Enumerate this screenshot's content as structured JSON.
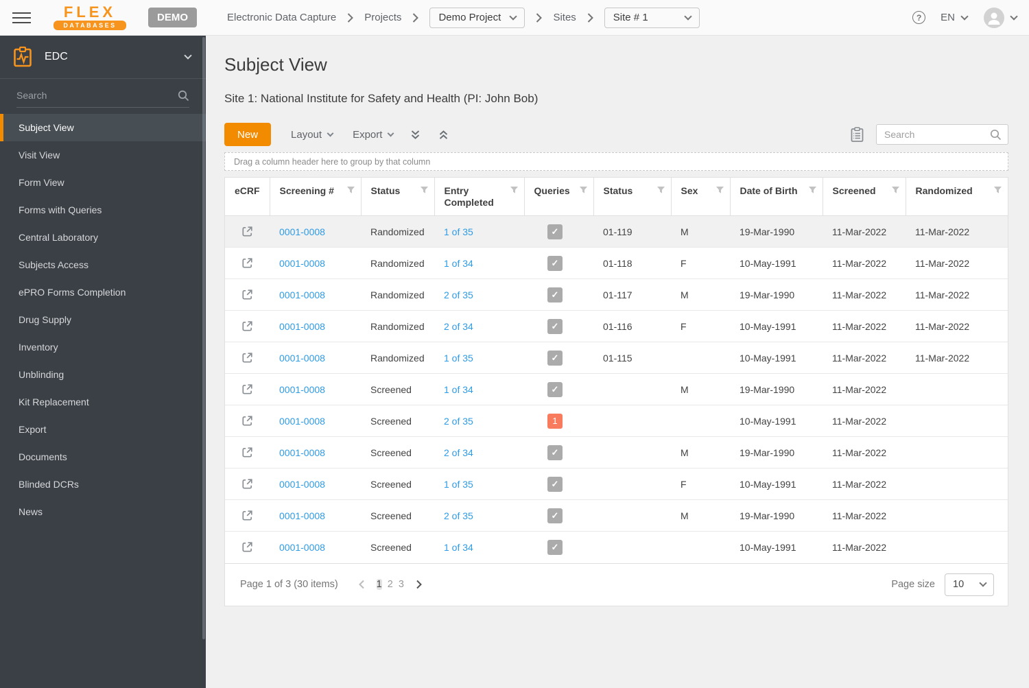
{
  "header": {
    "logo_line1": "FLEX",
    "logo_line2": "DATABASES",
    "demo_badge": "DEMO",
    "breadcrumb1": "Electronic Data Capture",
    "breadcrumb2": "Projects",
    "project_selected": "Demo Project",
    "breadcrumb3": "Sites",
    "site_selected": "Site # 1",
    "language": "EN"
  },
  "sidebar": {
    "module_label": "EDC",
    "search_placeholder": "Search",
    "items": [
      {
        "label": "Subject View",
        "active": true
      },
      {
        "label": "Visit View",
        "active": false
      },
      {
        "label": "Form View",
        "active": false
      },
      {
        "label": "Forms with Queries",
        "active": false
      },
      {
        "label": "Central Laboratory",
        "active": false
      },
      {
        "label": "Subjects Access",
        "active": false
      },
      {
        "label": "ePRO Forms Completion",
        "active": false
      },
      {
        "label": "Drug Supply",
        "active": false
      },
      {
        "label": "Inventory",
        "active": false
      },
      {
        "label": "Unblinding",
        "active": false
      },
      {
        "label": "Kit Replacement",
        "active": false
      },
      {
        "label": "Export",
        "active": false
      },
      {
        "label": "Documents",
        "active": false
      },
      {
        "label": "Blinded DCRs",
        "active": false
      },
      {
        "label": "News",
        "active": false
      }
    ]
  },
  "main": {
    "title": "Subject View",
    "subtitle": "Site 1: National Institute for Safety and Health (PI: John Bob)",
    "toolbar": {
      "new_label": "New",
      "layout_label": "Layout",
      "export_label": "Export",
      "search_placeholder": "Search"
    },
    "group_bar_text": "Drag a column header here to group by that column",
    "table": {
      "columns": [
        {
          "label": "eCRF",
          "filter": false
        },
        {
          "label": "Screening #",
          "filter": true
        },
        {
          "label": "Status",
          "filter": true
        },
        {
          "label": "Entry Completed",
          "filter": true
        },
        {
          "label": "Queries",
          "filter": true
        },
        {
          "label": "Status",
          "filter": true
        },
        {
          "label": "Sex",
          "filter": true
        },
        {
          "label": "Date of Birth",
          "filter": true
        },
        {
          "label": "Screened",
          "filter": true
        },
        {
          "label": "Randomized",
          "filter": true
        }
      ],
      "rows": [
        {
          "selected": true,
          "screening": "0001-0008",
          "status": "Randomized",
          "entry": "1 of 35",
          "queries": "check",
          "status2": "01-119",
          "sex": "M",
          "dob": "19-Mar-1990",
          "screened": "11-Mar-2022",
          "randomized": "11-Mar-2022"
        },
        {
          "selected": false,
          "screening": "0001-0008",
          "status": "Randomized",
          "entry": "1 of 34",
          "queries": "check",
          "status2": "01-118",
          "sex": "F",
          "dob": "10-May-1991",
          "screened": "11-Mar-2022",
          "randomized": "11-Mar-2022"
        },
        {
          "selected": false,
          "screening": "0001-0008",
          "status": "Randomized",
          "entry": "2 of 35",
          "queries": "check",
          "status2": "01-117",
          "sex": "M",
          "dob": "19-Mar-1990",
          "screened": "11-Mar-2022",
          "randomized": "11-Mar-2022"
        },
        {
          "selected": false,
          "screening": "0001-0008",
          "status": "Randomized",
          "entry": "2 of 34",
          "queries": "check",
          "status2": "01-116",
          "sex": "F",
          "dob": "10-May-1991",
          "screened": "11-Mar-2022",
          "randomized": "11-Mar-2022"
        },
        {
          "selected": false,
          "screening": "0001-0008",
          "status": "Randomized",
          "entry": "1 of 35",
          "queries": "check",
          "status2": "01-115",
          "sex": "",
          "dob": "10-May-1991",
          "screened": "11-Mar-2022",
          "randomized": "11-Mar-2022"
        },
        {
          "selected": false,
          "screening": "0001-0008",
          "status": "Screened",
          "entry": "1 of 34",
          "queries": "check",
          "status2": "",
          "sex": "M",
          "dob": "19-Mar-1990",
          "screened": "11-Mar-2022",
          "randomized": ""
        },
        {
          "selected": false,
          "screening": "0001-0008",
          "status": "Screened",
          "entry": "2 of 35",
          "queries": "1",
          "status2": "",
          "sex": "",
          "dob": "10-May-1991",
          "screened": "11-Mar-2022",
          "randomized": ""
        },
        {
          "selected": false,
          "screening": "0001-0008",
          "status": "Screened",
          "entry": "2 of 34",
          "queries": "check",
          "status2": "",
          "sex": "M",
          "dob": "19-Mar-1990",
          "screened": "11-Mar-2022",
          "randomized": ""
        },
        {
          "selected": false,
          "screening": "0001-0008",
          "status": "Screened",
          "entry": "1 of 35",
          "queries": "check",
          "status2": "",
          "sex": "F",
          "dob": "10-May-1991",
          "screened": "11-Mar-2022",
          "randomized": ""
        },
        {
          "selected": false,
          "screening": "0001-0008",
          "status": "Screened",
          "entry": "2 of 35",
          "queries": "check",
          "status2": "",
          "sex": "M",
          "dob": "19-Mar-1990",
          "screened": "11-Mar-2022",
          "randomized": ""
        },
        {
          "selected": false,
          "screening": "0001-0008",
          "status": "Screened",
          "entry": "1 of 34",
          "queries": "check",
          "status2": "",
          "sex": "",
          "dob": "10-May-1991",
          "screened": "11-Mar-2022",
          "randomized": ""
        }
      ]
    },
    "pagination": {
      "summary": "Page 1 of 3  (30 items)",
      "pages": [
        "1",
        "2",
        "3"
      ],
      "current_page": "1",
      "page_size_label": "Page size",
      "page_size_value": "10"
    }
  },
  "colors": {
    "accent_orange": "#f28b00",
    "logo_orange": "#f7941e",
    "link_blue": "#2e9be6",
    "query_badge": "#f87b5e",
    "sidebar_bg": "#3a4046"
  },
  "icons": {
    "check_glyph": "✓",
    "help_glyph": "?"
  }
}
